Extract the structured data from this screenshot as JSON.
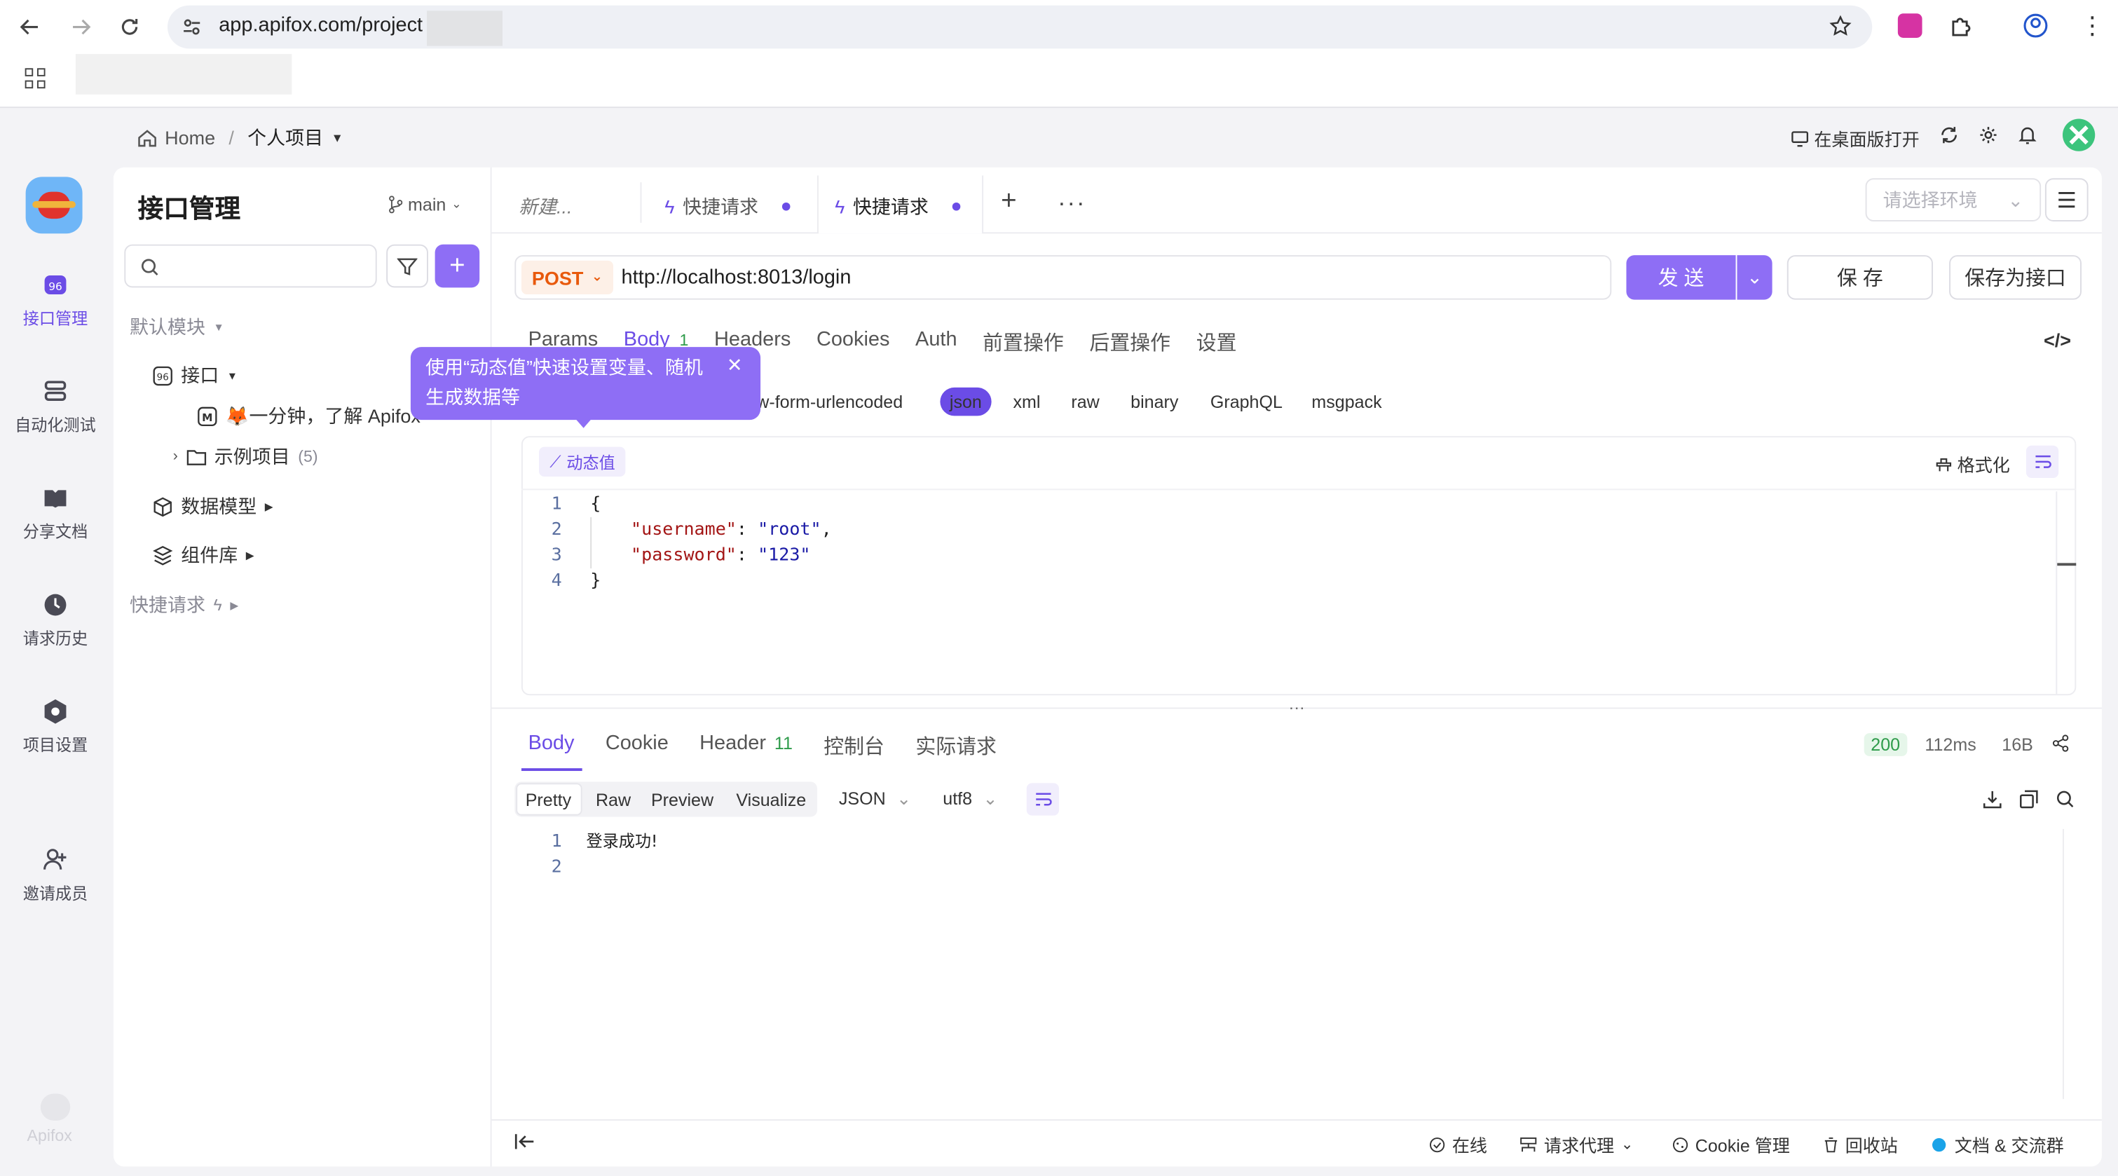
{
  "browser": {
    "url": "app.apifox.com/project"
  },
  "rail": {
    "items": [
      {
        "label": "接口管理",
        "icon": "api-icon",
        "active": true
      },
      {
        "label": "自动化测试",
        "icon": "stack-icon"
      },
      {
        "label": "分享文档",
        "icon": "book-icon"
      },
      {
        "label": "请求历史",
        "icon": "clock-icon"
      },
      {
        "label": "项目设置",
        "icon": "hexagon-icon"
      },
      {
        "label": "邀请成员",
        "icon": "user-add-icon"
      }
    ],
    "brand": "Apifox"
  },
  "header": {
    "home": "Home",
    "separator": "/",
    "project": "个人项目",
    "open_desktop": "在桌面版打开"
  },
  "left": {
    "title": "接口管理",
    "branch": "main",
    "default_module": "默认模块",
    "tree_api": "接口",
    "tree_doc": "🦊一分钟，了解 Apifox",
    "tree_example": "示例项目",
    "tree_example_count": "(5)",
    "data_model": "数据模型",
    "component_lib": "组件库",
    "quick_request": "快捷请求"
  },
  "tabs": {
    "new": "新建...",
    "t1": "快捷请求",
    "t2": "快捷请求",
    "env_placeholder": "请选择环境"
  },
  "request": {
    "method": "POST",
    "url": "http://localhost:8013/login",
    "send": "发 送",
    "save": "保 存",
    "save_api": "保存为接口"
  },
  "req_tabs": [
    "Params",
    "Body",
    "Headers",
    "Cookies",
    "Auth",
    "前置操作",
    "后置操作",
    "设置"
  ],
  "req_body_count": "1",
  "body_types": [
    "x-www-form-urlencoded",
    "json",
    "xml",
    "raw",
    "binary",
    "GraphQL",
    "msgpack"
  ],
  "body_types_partial": "w-form-urlencoded",
  "dynamic": "动态值",
  "format": "格式化",
  "tooltip": "使用“动态值”快速设置变量、随机生成数据等",
  "code_lines": [
    {
      "n": "1",
      "text": "{"
    },
    {
      "n": "2",
      "key": "\"username\"",
      "val": "\"root\"",
      "tail": ","
    },
    {
      "n": "3",
      "key": "\"password\"",
      "val": "\"123\"",
      "tail": ""
    },
    {
      "n": "4",
      "text": "}"
    }
  ],
  "resp_tabs": [
    "Body",
    "Cookie",
    "Header",
    "控制台",
    "实际请求"
  ],
  "resp_header_count": "11",
  "resp_status": "200",
  "resp_time": "112ms",
  "resp_size": "16B",
  "resp_views": [
    "Pretty",
    "Raw",
    "Preview",
    "Visualize"
  ],
  "resp_format": "JSON",
  "resp_encoding": "utf8",
  "resp_lines": [
    {
      "n": "1",
      "text": "登录成功!"
    },
    {
      "n": "2",
      "text": ""
    }
  ],
  "footer": {
    "online": "在线",
    "proxy": "请求代理",
    "cookie": "Cookie 管理",
    "trash": "回收站",
    "docs": "文档 & 交流群"
  },
  "colors": {
    "accent": "#6b4ce6",
    "accent_light": "#8e6ef5",
    "post": "#e8590c"
  }
}
